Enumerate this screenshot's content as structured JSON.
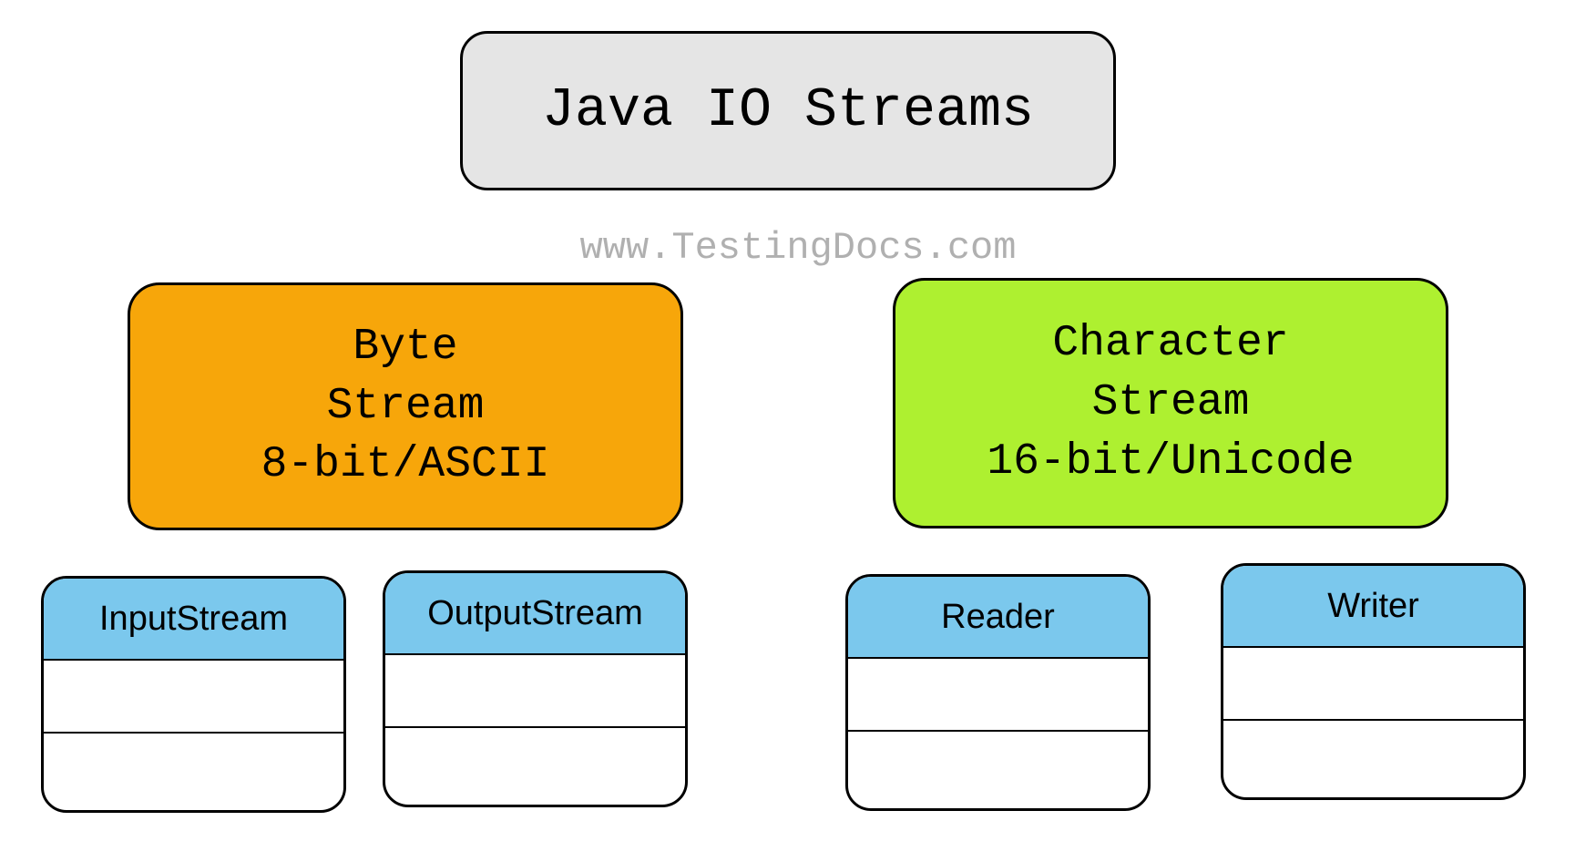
{
  "title": "Java IO Streams",
  "watermark": "www.TestingDocs.com",
  "byte_stream": {
    "line1": "Byte",
    "line2": "Stream",
    "line3": "8-bit/ASCII"
  },
  "char_stream": {
    "line1": "Character",
    "line2": "Stream",
    "line3": "16-bit/Unicode"
  },
  "classes": {
    "inputstream": "InputStream",
    "outputstream": "OutputStream",
    "reader": "Reader",
    "writer": "Writer"
  }
}
